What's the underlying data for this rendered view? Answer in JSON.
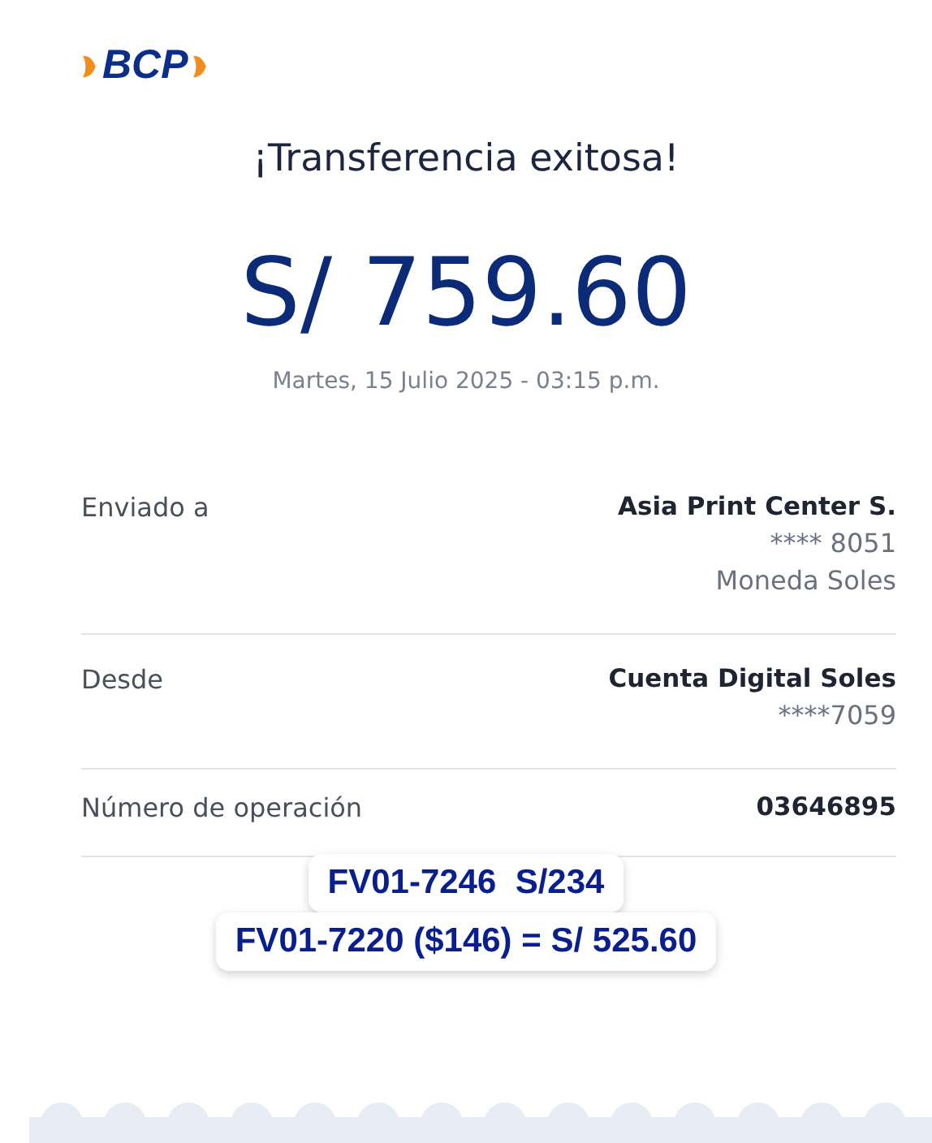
{
  "logo": {
    "text": "BCP"
  },
  "title": "¡Transferencia exitosa!",
  "amount": "S/ 759.60",
  "datetime": "Martes, 15 Julio 2025 - 03:15 p.m.",
  "details": [
    {
      "label": "Enviado a",
      "values": [
        "Asia Print Center S.",
        "**** 8051",
        "Moneda Soles"
      ]
    },
    {
      "label": "Desde",
      "values": [
        "Cuenta Digital Soles",
        "****7059"
      ]
    },
    {
      "label": "Número de operación",
      "values": [
        "03646895"
      ]
    }
  ],
  "notes": [
    "FV01-7246  S/234",
    "FV01-7220 ($146) = S/ 525.60"
  ]
}
